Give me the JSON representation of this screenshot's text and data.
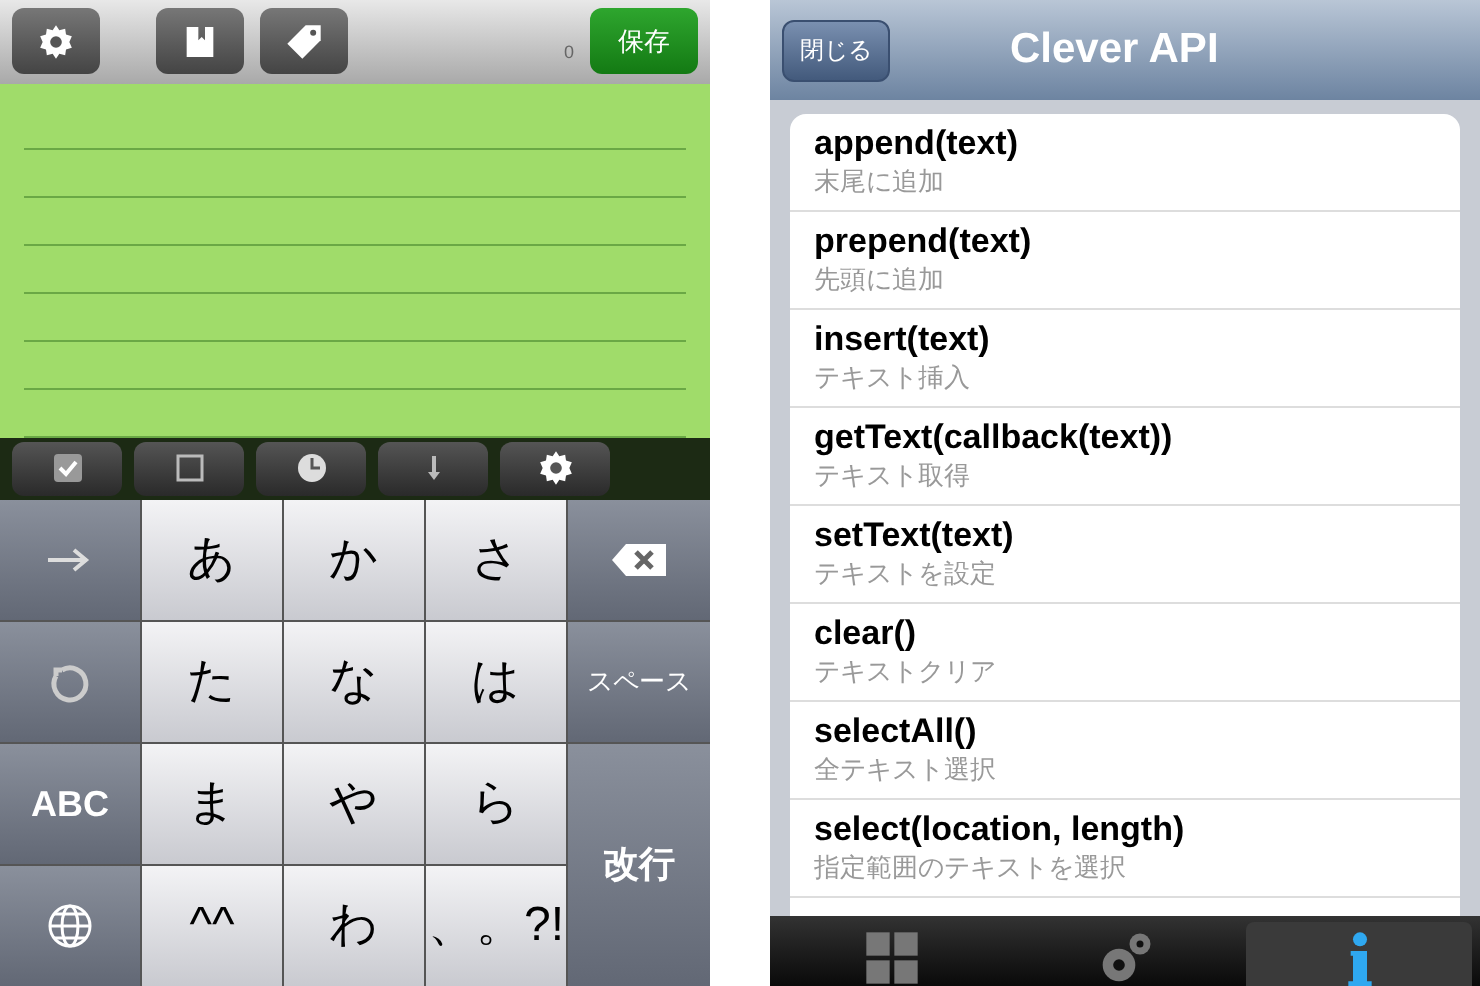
{
  "editor": {
    "toolbar": [
      {
        "kind": "gear"
      },
      {
        "kind": "book"
      },
      {
        "kind": "tag"
      }
    ],
    "count": "0",
    "save_button": "保存",
    "format_bar": [
      {
        "kind": "checked-box"
      },
      {
        "kind": "empty-box"
      },
      {
        "kind": "clock"
      },
      {
        "kind": "down-arrow"
      },
      {
        "kind": "gear"
      }
    ]
  },
  "keyboard": {
    "keys": [
      {
        "kind": "arrow"
      },
      {
        "kind": "kana",
        "label": "あ"
      },
      {
        "kind": "kana",
        "label": "か"
      },
      {
        "kind": "kana",
        "label": "さ"
      },
      {
        "kind": "delete"
      },
      {
        "kind": "undo"
      },
      {
        "kind": "kana",
        "label": "た"
      },
      {
        "kind": "kana",
        "label": "な"
      },
      {
        "kind": "kana",
        "label": "は"
      },
      {
        "kind": "function",
        "label": "スペース"
      },
      {
        "kind": "function",
        "label": "ABC"
      },
      {
        "kind": "kana",
        "label": "ま"
      },
      {
        "kind": "kana",
        "label": "や"
      },
      {
        "kind": "kana",
        "label": "ら"
      },
      {
        "kind": "function",
        "label": "改行",
        "tall": true
      },
      {
        "kind": "globe"
      },
      {
        "kind": "kana",
        "label": "^^"
      },
      {
        "kind": "kana",
        "label": "わ"
      },
      {
        "kind": "kana",
        "label": "、。?!"
      }
    ]
  },
  "api_screen": {
    "close_button": "閉じる",
    "title": "Clever API",
    "items": [
      {
        "name": "append(text)",
        "description": "末尾に追加"
      },
      {
        "name": "prepend(text)",
        "description": "先頭に追加"
      },
      {
        "name": "insert(text)",
        "description": "テキスト挿入"
      },
      {
        "name": "getText(callback(text))",
        "description": "テキスト取得"
      },
      {
        "name": "setText(text)",
        "description": "テキストを設定"
      },
      {
        "name": "clear()",
        "description": "テキストクリア"
      },
      {
        "name": "selectAll()",
        "description": "全テキスト選択"
      },
      {
        "name": "select(location, length)",
        "description": "指定範囲のテキストを選択"
      }
    ],
    "tabs": [
      {
        "kind": "grid",
        "selected": false
      },
      {
        "kind": "gears",
        "selected": false
      },
      {
        "kind": "info",
        "selected": true
      }
    ]
  }
}
